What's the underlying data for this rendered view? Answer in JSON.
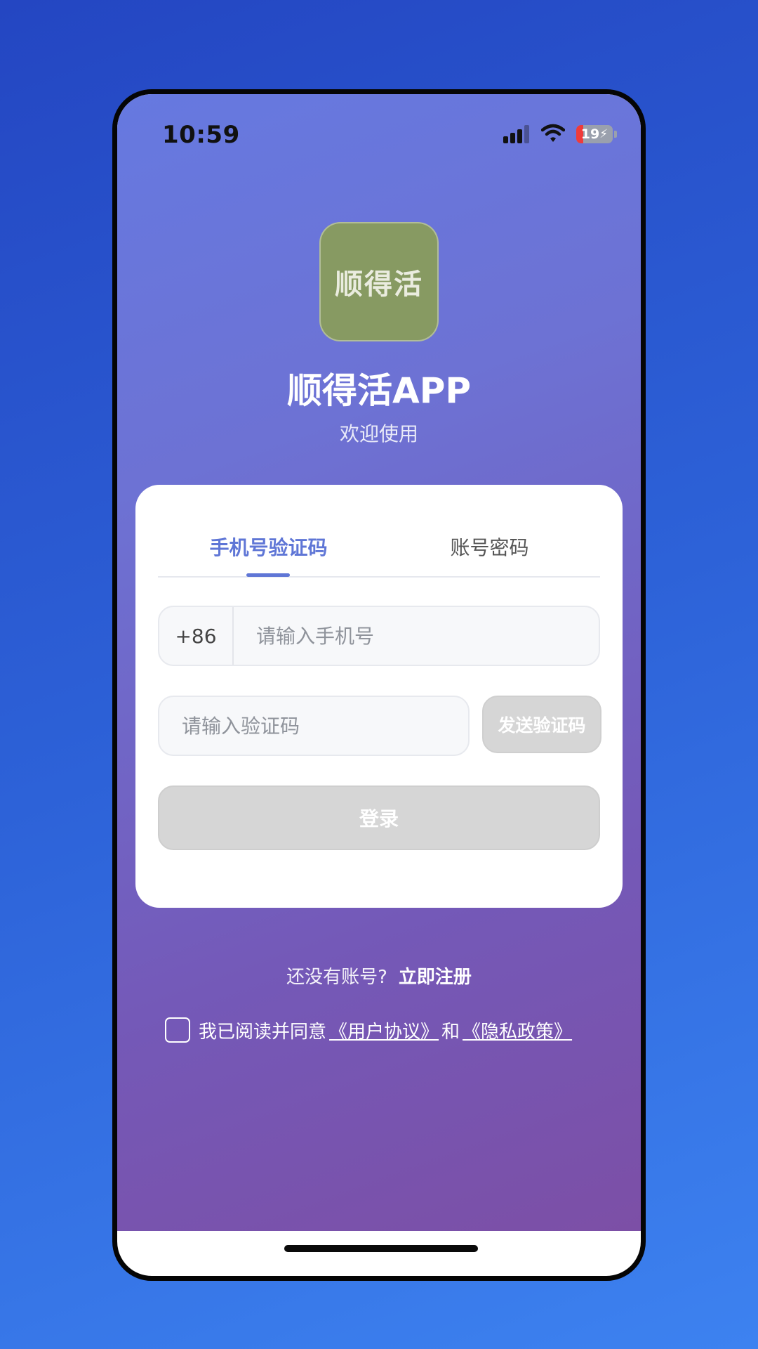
{
  "status_bar": {
    "time": "10:59",
    "battery_level": "19",
    "battery_fraction": 0.19,
    "icons": [
      "signal-icon",
      "wifi-icon",
      "battery-charging-icon"
    ]
  },
  "app": {
    "logo_text": "顺得活",
    "title": "顺得活APP",
    "subtitle": "欢迎使用"
  },
  "login_card": {
    "tabs": [
      {
        "label": "手机号验证码",
        "active": true
      },
      {
        "label": "账号密码",
        "active": false
      }
    ],
    "phone": {
      "country_code": "+86",
      "placeholder": "请输入手机号",
      "value": ""
    },
    "code": {
      "placeholder": "请输入验证码",
      "value": "",
      "send_label": "发送验证码"
    },
    "login_label": "登录"
  },
  "register": {
    "prompt": "还没有账号?",
    "link": "立即注册"
  },
  "agreement": {
    "checked": false,
    "prefix": "我已阅读并同意",
    "user_agreement": "《用户协议》",
    "conjunction": "和",
    "privacy_policy": "《隐私政策》"
  },
  "colors": {
    "accent": "#5f76d6",
    "disabled_button": "#d6d6d6",
    "logo_bg": "#879a62",
    "battery_low": "#ef3b3b"
  }
}
